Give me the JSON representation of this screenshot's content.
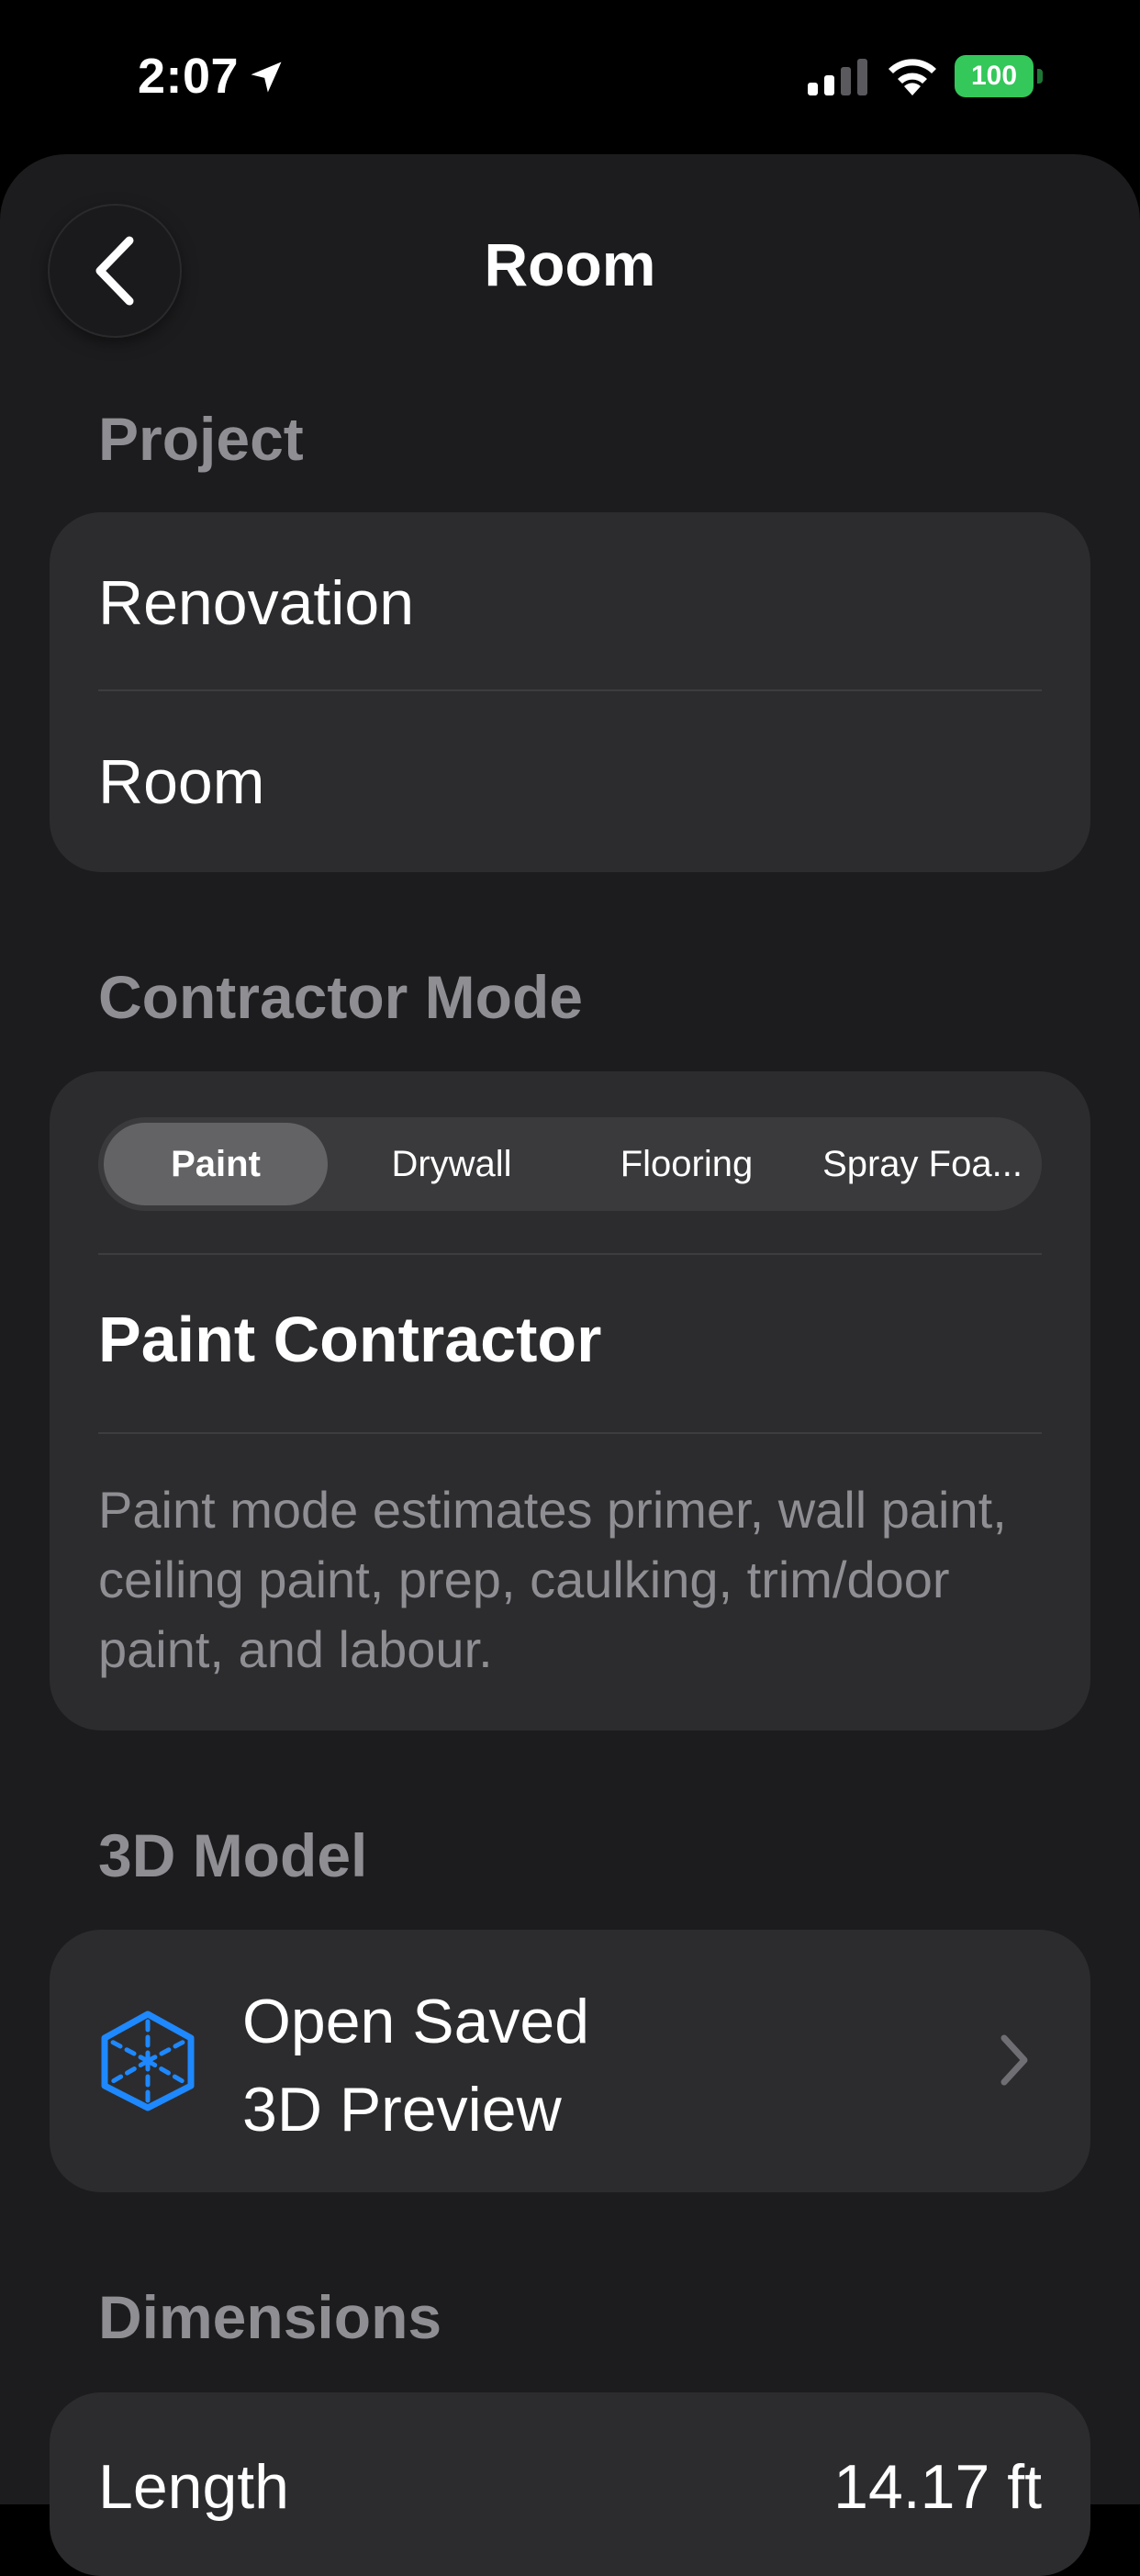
{
  "status_bar": {
    "time": "2:07",
    "battery": "100",
    "battery_color": "#34c759"
  },
  "nav": {
    "title": "Room",
    "back_icon": "chevron-left-icon"
  },
  "project": {
    "header": "Project",
    "items": [
      "Renovation",
      "Room"
    ]
  },
  "contractor_mode": {
    "header": "Contractor Mode",
    "segments": [
      "Paint",
      "Drywall",
      "Flooring",
      "Spray Foa..."
    ],
    "selected": "Paint",
    "title": "Paint Contractor",
    "description": "Paint mode estimates primer, wall paint, ceiling paint, prep, caulking, trim/door paint, and labour."
  },
  "model": {
    "header": "3D Model",
    "button_line1": "Open Saved",
    "button_line2": "3D Preview",
    "icon": "cube-icon",
    "accent": "#1e88ff"
  },
  "dimensions": {
    "header": "Dimensions",
    "first_label": "Length",
    "first_value": "14.17 ft"
  }
}
